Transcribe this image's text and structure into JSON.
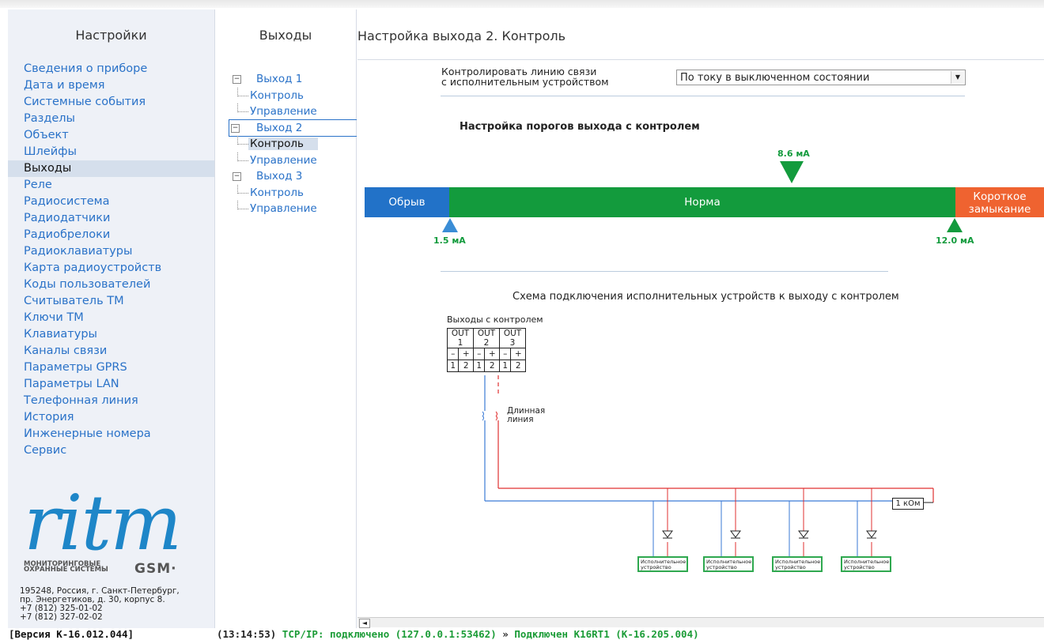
{
  "settings": {
    "title": "Настройки",
    "items": [
      "Сведения о приборе",
      "Дата и время",
      "Системные события",
      "Разделы",
      "Объект",
      "Шлейфы",
      "Выходы",
      "Реле",
      "Радиосистема",
      "Радиодатчики",
      "Радиобрелоки",
      "Радиоклавиатуры",
      "Карта радиоустройств",
      "Коды пользователей",
      "Считыватель ТМ",
      "Ключи ТМ",
      "Клавиатуры",
      "Каналы связи",
      "Параметры GPRS",
      "Параметры LAN",
      "Телефонная линия",
      "История",
      "Инженерные номера",
      "Сервис"
    ],
    "active_index": 6
  },
  "logo": {
    "word": "ritm",
    "sub1": "МОНИТОРИНГОВЫЕ",
    "sub2": "ОХРАННЫЕ СИСТЕМЫ",
    "gsm": "GSM·",
    "address": [
      "195248, Россия, г. Санкт-Петербург,",
      "пр. Энергетиков, д. 30, корпус 8.",
      "+7 (812) 325-01-02",
      "+7 (812) 327-02-02"
    ]
  },
  "outputs_tree": {
    "title": "Выходы",
    "groups": [
      {
        "label": "Выход 1",
        "children": [
          "Контроль",
          "Управление"
        ]
      },
      {
        "label": "Выход 2",
        "children": [
          "Контроль",
          "Управление"
        ]
      },
      {
        "label": "Выход 3",
        "children": [
          "Контроль",
          "Управление"
        ]
      }
    ],
    "selected_group": 1,
    "selected_leaf": "Контроль"
  },
  "main": {
    "title": "Настройка выхода 2. Контроль",
    "control_label_line1": "Контролировать линию связи",
    "control_label_line2": "с исполнительным устройством",
    "control_value": "По току в выключенном состоянии",
    "thresholds_title": "Настройка порогов выхода с контролем",
    "bar_break": "Обрыв",
    "bar_norm": "Норма",
    "bar_short_1": "Короткое",
    "bar_short_2": "замыкание",
    "marker_top": "8.6 мА",
    "marker_left": "1.5 мА",
    "marker_right": "12.0 мА",
    "scheme_title": "Схема подключения исполнительных устройств к выходу с контролем",
    "outputs_label": "Выходы с контролем",
    "out_headers": [
      "OUT 1",
      "OUT 2",
      "OUT 3"
    ],
    "out_polarity": [
      "–",
      "+",
      "–",
      "+",
      "–",
      "+"
    ],
    "out_pins": [
      "1",
      "2",
      "1",
      "2",
      "1",
      "2"
    ],
    "long_line_1": "Длинная",
    "long_line_2": "линия",
    "resistor": "1 кОм",
    "device_1": "Исполнительное",
    "device_2": "устройство"
  },
  "status": {
    "version": "[Версия К-16.012.044]",
    "time": "(13:14:53)",
    "tcp": "TCP/IP: подключено (127.0.0.1:53462)",
    "arrow": "»",
    "device": "Подключен K16RT1 (K-16.205.004)"
  },
  "colors": {
    "link": "#2a72c8",
    "break": "#2272c8",
    "norm": "#139b3d",
    "short": "#ef6330"
  }
}
